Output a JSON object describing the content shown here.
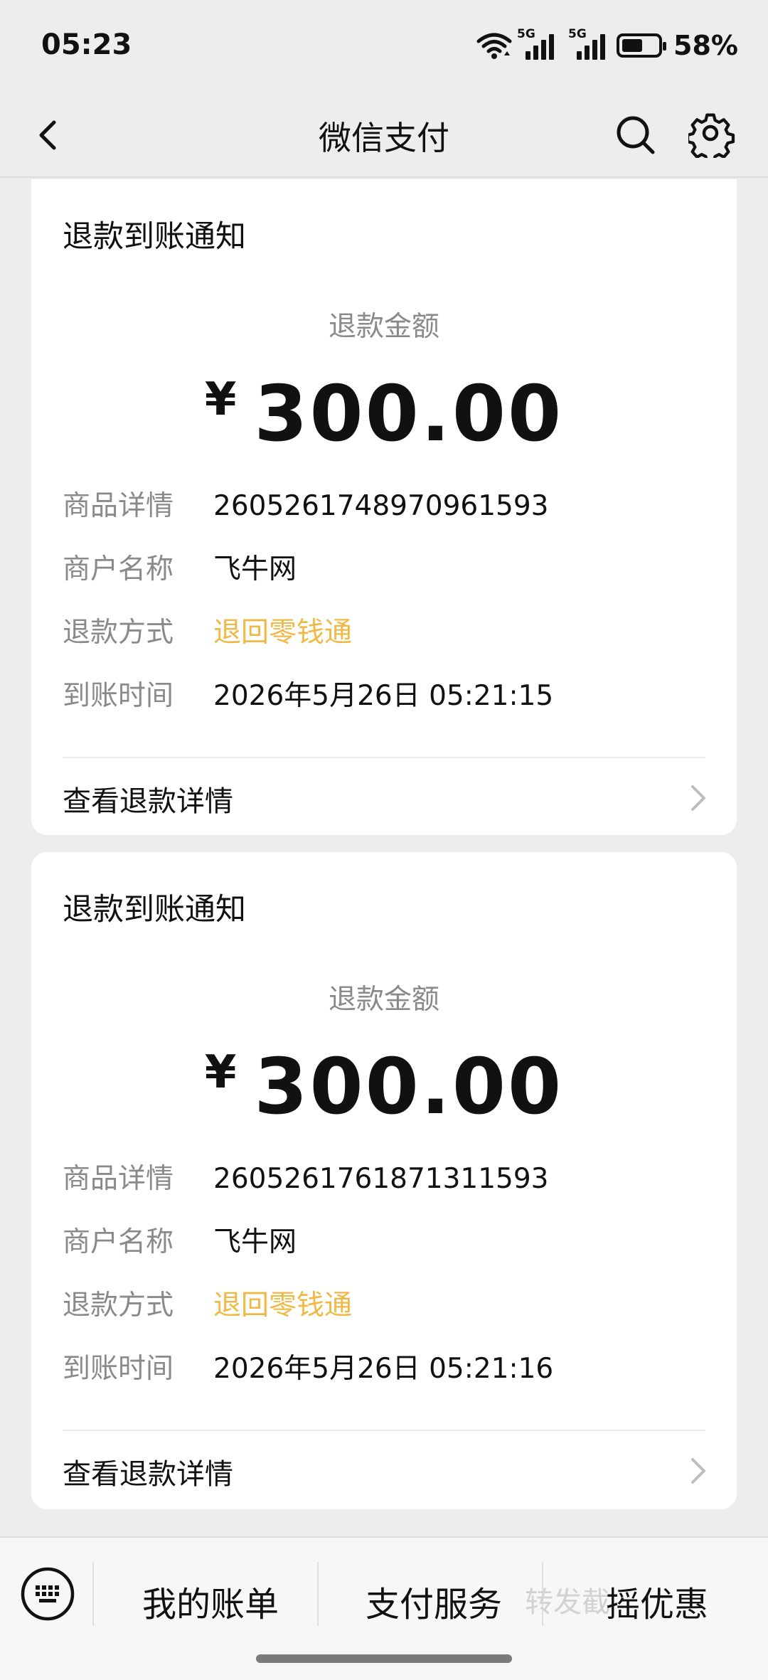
{
  "status_bar": {
    "time": "05:23",
    "network_1": "5G",
    "network_2": "5G",
    "battery_percent": "58%",
    "battery_level": 0.58
  },
  "nav": {
    "title": "微信支付",
    "back_icon": "chevron-left-icon",
    "search_icon": "search-icon",
    "settings_icon": "gear-icon"
  },
  "cards": [
    {
      "heading": "退款到账通知",
      "amount_label": "退款金额",
      "currency_symbol": "¥",
      "amount": "300.00",
      "rows": [
        {
          "key": "商品详情",
          "value": "2605261748970961593"
        },
        {
          "key": "商户名称",
          "value": "飞牛网"
        },
        {
          "key": "退款方式",
          "value": "退回零钱通"
        },
        {
          "key": "到账时间",
          "value": "2026年5月26日 05:21:15"
        }
      ],
      "detail_link": "查看退款详情"
    },
    {
      "heading": "退款到账通知",
      "amount_label": "退款金额",
      "currency_symbol": "¥",
      "amount": "300.00",
      "rows": [
        {
          "key": "商品详情",
          "value": "2605261761871311593"
        },
        {
          "key": "商户名称",
          "value": "飞牛网"
        },
        {
          "key": "退款方式",
          "value": "退回零钱通"
        },
        {
          "key": "到账时间",
          "value": "2026年5月26日 05:21:16"
        }
      ],
      "detail_link": "查看退款详情"
    }
  ],
  "accent_color": "#f0b844",
  "bottom_menu": {
    "keyboard_icon": "keyboard-icon",
    "items": [
      "我的账单",
      "支付服务",
      "摇优惠"
    ],
    "ghost_text": "转发截"
  }
}
